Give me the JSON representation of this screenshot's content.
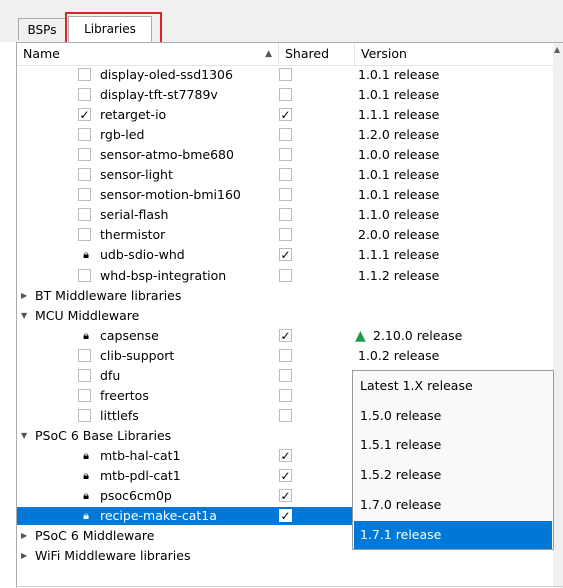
{
  "tabs": [
    {
      "label": "BSPs",
      "active": false
    },
    {
      "label": "Libraries",
      "active": true
    }
  ],
  "columns": {
    "name": "Name",
    "shared": "Shared",
    "version": "Version"
  },
  "rows": [
    {
      "type": "item",
      "name": "display-oled-ssd1306",
      "checked": false,
      "locked": false,
      "shared": false,
      "version": "1.0.1 release"
    },
    {
      "type": "item",
      "name": "display-tft-st7789v",
      "checked": false,
      "locked": false,
      "shared": false,
      "version": "1.0.1 release"
    },
    {
      "type": "item",
      "name": "retarget-io",
      "checked": true,
      "locked": false,
      "shared": true,
      "version": "1.1.1 release"
    },
    {
      "type": "item",
      "name": "rgb-led",
      "checked": false,
      "locked": false,
      "shared": false,
      "version": "1.2.0 release"
    },
    {
      "type": "item",
      "name": "sensor-atmo-bme680",
      "checked": false,
      "locked": false,
      "shared": false,
      "version": "1.0.0 release"
    },
    {
      "type": "item",
      "name": "sensor-light",
      "checked": false,
      "locked": false,
      "shared": false,
      "version": "1.0.1 release"
    },
    {
      "type": "item",
      "name": "sensor-motion-bmi160",
      "checked": false,
      "locked": false,
      "shared": false,
      "version": "1.0.1 release"
    },
    {
      "type": "item",
      "name": "serial-flash",
      "checked": false,
      "locked": false,
      "shared": false,
      "version": "1.1.0 release"
    },
    {
      "type": "item",
      "name": "thermistor",
      "checked": false,
      "locked": false,
      "shared": false,
      "version": "2.0.0 release"
    },
    {
      "type": "item",
      "name": "udb-sdio-whd",
      "checked": true,
      "locked": true,
      "shared": true,
      "version": "1.1.1 release"
    },
    {
      "type": "item",
      "name": "whd-bsp-integration",
      "checked": false,
      "locked": false,
      "shared": false,
      "version": "1.1.2 release"
    },
    {
      "type": "group",
      "name": "BT Middleware libraries",
      "expanded": false
    },
    {
      "type": "group",
      "name": "MCU Middleware",
      "expanded": true
    },
    {
      "type": "item",
      "name": "capsense",
      "checked": true,
      "locked": true,
      "shared": true,
      "version": "2.10.0 release",
      "update_icon": true
    },
    {
      "type": "item",
      "name": "clib-support",
      "checked": false,
      "locked": false,
      "shared": false,
      "version": "1.0.2 release"
    },
    {
      "type": "item",
      "name": "dfu",
      "checked": false,
      "locked": false,
      "shared": false,
      "version": ""
    },
    {
      "type": "item",
      "name": "freertos",
      "checked": false,
      "locked": false,
      "shared": false,
      "version": ""
    },
    {
      "type": "item",
      "name": "littlefs",
      "checked": false,
      "locked": false,
      "shared": false,
      "version": ""
    },
    {
      "type": "group",
      "name": "PSoC 6 Base Libraries",
      "expanded": true
    },
    {
      "type": "item",
      "name": "mtb-hal-cat1",
      "checked": true,
      "locked": true,
      "shared": true,
      "version": ""
    },
    {
      "type": "item",
      "name": "mtb-pdl-cat1",
      "checked": true,
      "locked": true,
      "shared": true,
      "version": ""
    },
    {
      "type": "item",
      "name": "psoc6cm0p",
      "checked": true,
      "locked": true,
      "shared": true,
      "version": ""
    },
    {
      "type": "item",
      "name": "recipe-make-cat1a",
      "checked": true,
      "locked": true,
      "shared": true,
      "version": "",
      "selected": true
    },
    {
      "type": "group",
      "name": "PSoC 6 Middleware",
      "expanded": false
    },
    {
      "type": "group",
      "name": "WiFi Middleware libraries",
      "expanded": false
    }
  ],
  "version_dropdown": {
    "options": [
      "Latest 1.X release",
      "1.5.0 release",
      "1.5.1 release",
      "1.5.2 release",
      "1.7.0 release",
      "1.7.1 release"
    ],
    "selected": "1.7.1 release"
  },
  "colors": {
    "selection": "#0078d7",
    "tab_highlight": "#e3202a",
    "update_icon": "#1e9e4a"
  }
}
